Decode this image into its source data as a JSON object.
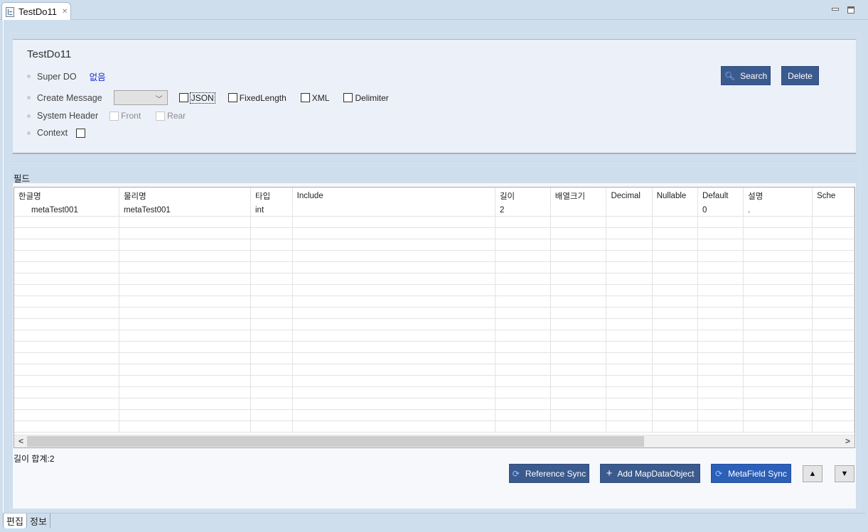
{
  "editor_tab": {
    "title": "TestDo11",
    "close_icon": "close-icon"
  },
  "window_controls": {
    "minimize": "minimize-icon",
    "maximize": "maximize-icon"
  },
  "header": {
    "title": "TestDo11",
    "super_do": {
      "label": "Super DO",
      "value": "없음"
    },
    "create_message": {
      "label": "Create Message",
      "combo_value": "",
      "options": [
        {
          "label": "JSON",
          "checked": false,
          "focused": true
        },
        {
          "label": "FixedLength",
          "checked": false
        },
        {
          "label": "XML",
          "checked": false
        },
        {
          "label": "Delimiter",
          "checked": false
        }
      ]
    },
    "system_header": {
      "label": "System Header",
      "options": [
        {
          "label": "Front",
          "checked": false,
          "disabled": true
        },
        {
          "label": "Rear",
          "checked": false,
          "disabled": true
        }
      ]
    },
    "context": {
      "label": "Context",
      "checked": false
    },
    "buttons": {
      "search": "Search",
      "delete": "Delete"
    }
  },
  "fields": {
    "section_label": "필드",
    "columns": [
      "한글명",
      "물리명",
      "타입",
      "Include",
      "길이",
      "배열크기",
      "Decimal",
      "Nullable",
      "Default",
      "설명",
      "Sche"
    ],
    "rows": [
      [
        "metaTest001",
        "metaTest001",
        "int",
        "",
        "2",
        "",
        "",
        "",
        "0",
        ".",
        ""
      ]
    ],
    "length_sum": "길이 합계:2",
    "buttons": {
      "reference_sync": "Reference Sync",
      "add_map_data_object": "Add MapDataObject",
      "metafield_sync": "MetaField Sync",
      "move_up": "▲",
      "move_down": "▼"
    }
  },
  "bottom_tabs": [
    {
      "label": "편집",
      "active": true
    },
    {
      "label": "정보",
      "active": false
    }
  ],
  "colors": {
    "button_primary": "#3b5a8e",
    "button_active": "#2b5fb8",
    "link": "#1a2fd6",
    "background": "#cfdeed"
  }
}
